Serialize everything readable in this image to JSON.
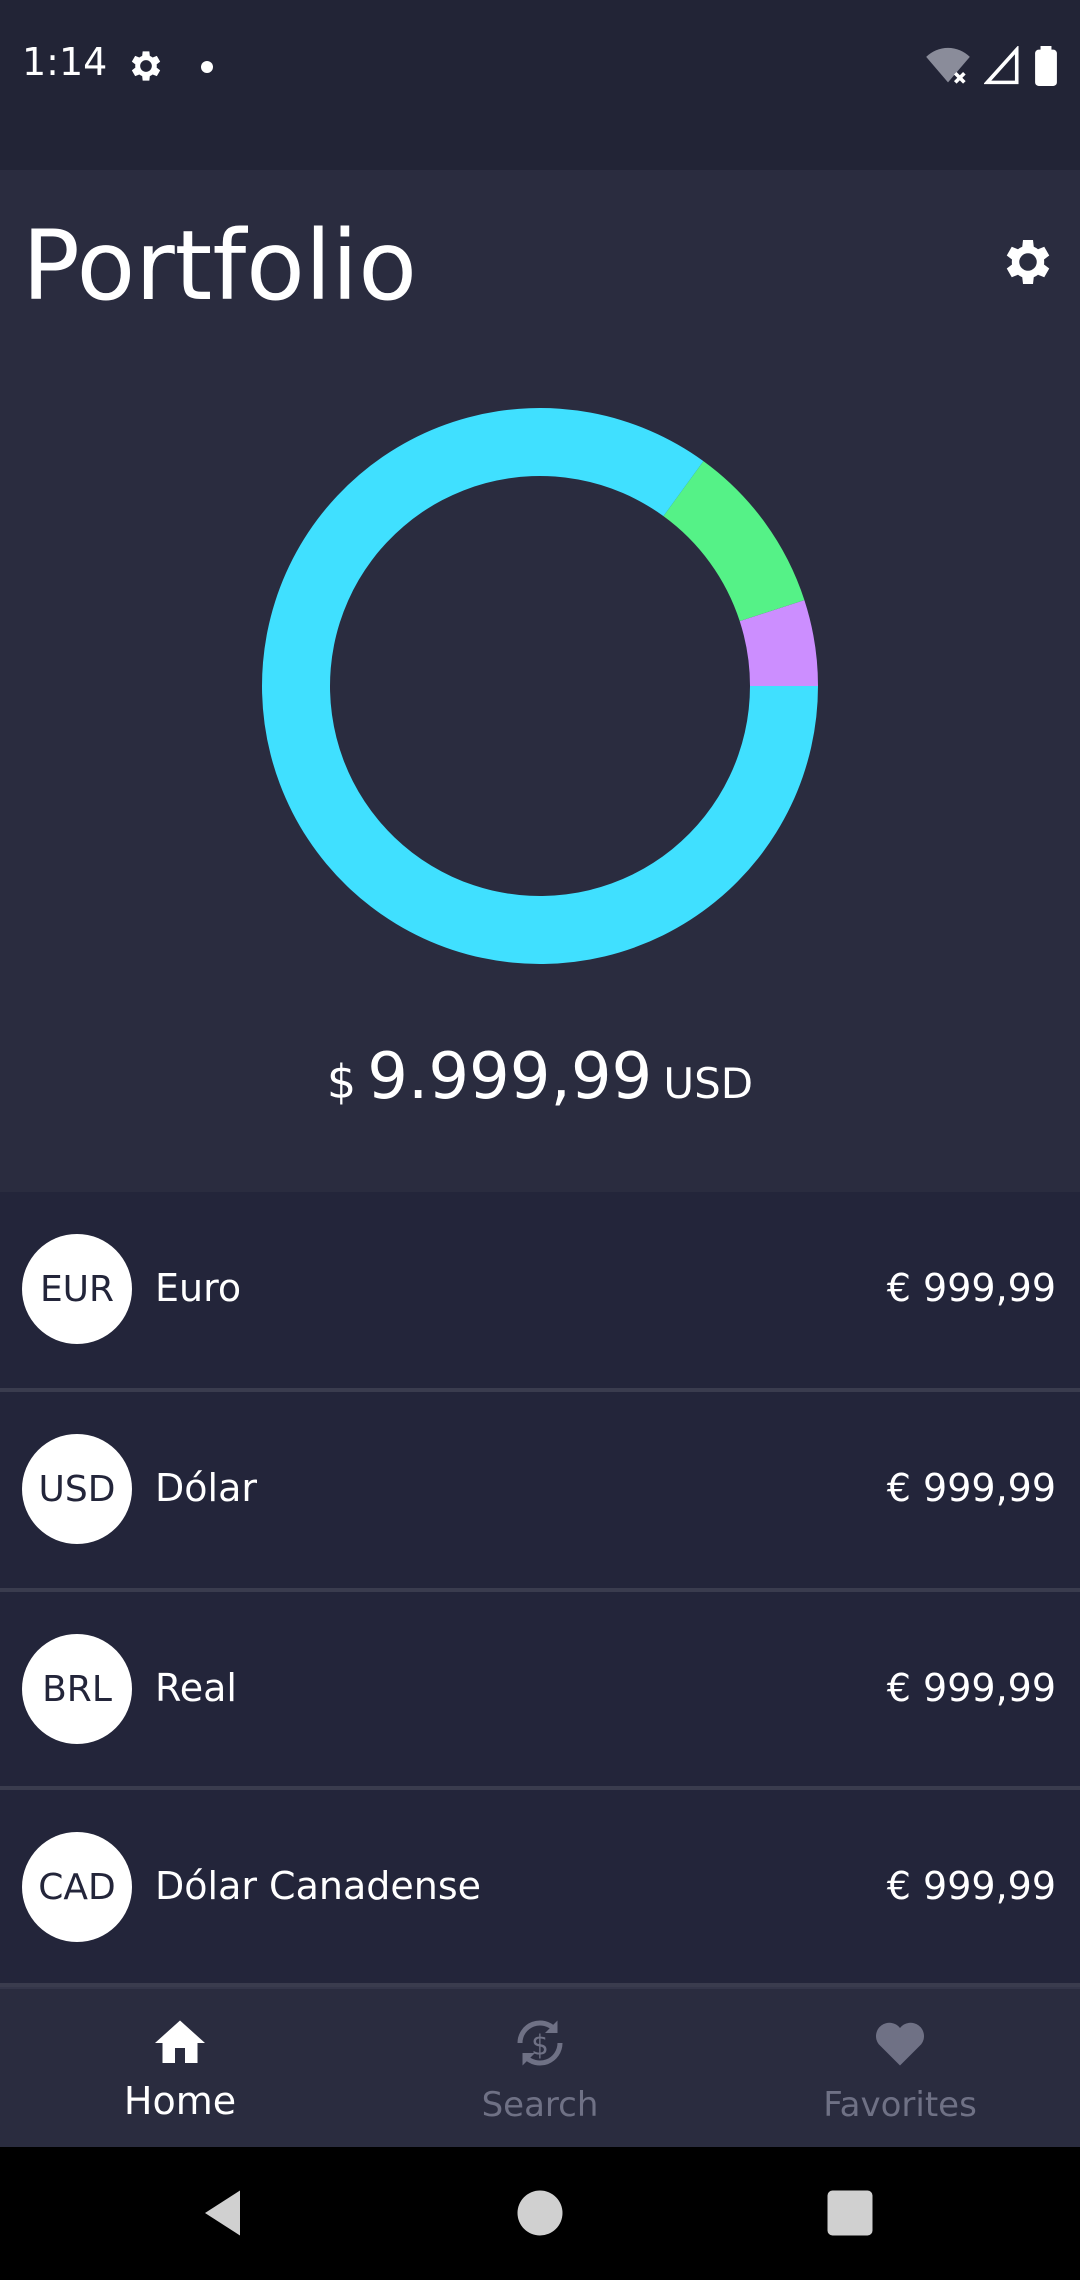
{
  "status_bar": {
    "time": "1:14"
  },
  "header": {
    "title": "Portfolio"
  },
  "chart_data": {
    "type": "pie",
    "style": "donut",
    "categories": [
      "Cyan",
      "Green",
      "Purple"
    ],
    "values": [
      85,
      10,
      5
    ],
    "colors": [
      "#40e0ff",
      "#55f287",
      "#cc8eff"
    ]
  },
  "total": {
    "symbol": "$",
    "amount": "9.999,99",
    "currency": "USD"
  },
  "holdings": [
    {
      "code": "EUR",
      "name": "Euro",
      "value": "€ 999,99"
    },
    {
      "code": "USD",
      "name": "Dólar",
      "value": "€ 999,99"
    },
    {
      "code": "BRL",
      "name": "Real",
      "value": "€ 999,99"
    },
    {
      "code": "CAD",
      "name": "Dólar Canadense",
      "value": "€ 999,99"
    }
  ],
  "nav": {
    "home": "Home",
    "search": "Search",
    "favorites": "Favorites",
    "active_color": "#ffffff",
    "inactive_color": "#6f7185"
  },
  "icons": [
    "gear-icon",
    "wifi-off-icon",
    "signal-icon",
    "battery-icon",
    "home-icon",
    "currency-exchange-icon",
    "heart-icon",
    "back-icon",
    "home-circle-icon",
    "recents-icon"
  ]
}
